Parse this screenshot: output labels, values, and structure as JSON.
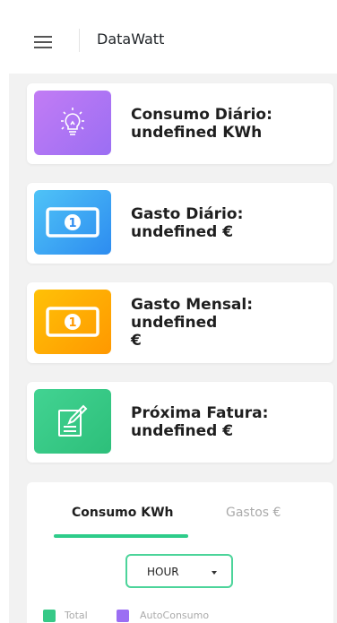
{
  "header": {
    "brand": "DataWatt"
  },
  "cards": [
    {
      "title": "Consumo Diário:",
      "value": "undefined KWh",
      "icon": "lightbulb-icon",
      "color": "#a47cf4"
    },
    {
      "title": "Gasto Diário: undefined €",
      "value": "",
      "icon": "banknote-icon",
      "color": "#3fa9f5"
    },
    {
      "title": "Gasto Mensal: undefined",
      "value": "€",
      "icon": "banknote-icon",
      "color": "#ffb300"
    },
    {
      "title": "Próxima Fatura:",
      "value": "undefined €",
      "icon": "edit-document-icon",
      "color": "#36c987"
    }
  ],
  "chart_panel": {
    "tabs": [
      {
        "label": "Consumo KWh",
        "active": true
      },
      {
        "label": "Gastos €",
        "active": false
      }
    ],
    "select": {
      "value": "HOUR"
    },
    "legend": [
      {
        "label": "Total",
        "color": "#36c987"
      },
      {
        "label": "AutoConsumo",
        "color": "#9b6ef3"
      }
    ]
  },
  "colors": {
    "accent_green": "#2ecc8a",
    "background": "#f2f2f2"
  }
}
